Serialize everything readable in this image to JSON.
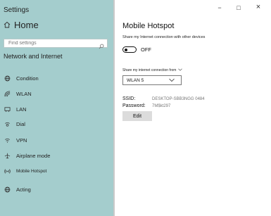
{
  "window": {
    "minimize_glyph": "−",
    "maximize_glyph": "□",
    "close_glyph": "×"
  },
  "sidebar": {
    "title": "Settings",
    "home_label": "Home",
    "search_placeholder": "Find settings",
    "section_title": "Network and Internet",
    "items": [
      {
        "label": "Condition",
        "icon": "globe-icon"
      },
      {
        "label": "WLAN",
        "icon": "wifi-icon"
      },
      {
        "label": "LAN",
        "icon": "ethernet-icon"
      },
      {
        "label": "Dial",
        "icon": "dialup-icon"
      },
      {
        "label": "VPN",
        "icon": "vpn-icon"
      },
      {
        "label": "Airplane mode",
        "icon": "airplane-icon"
      },
      {
        "label": "Mobile Hotspot",
        "icon": "hotspot-icon"
      },
      {
        "label": "Acting",
        "icon": "proxy-icon"
      }
    ]
  },
  "main": {
    "title": "Mobile Hotspot",
    "description": "Share my Internet connection with other devices",
    "toggle": {
      "state_label": "OFF",
      "on": false
    },
    "share_from_label": "Share my internet connection from",
    "share_from_value": "WLAN 5",
    "ssid_label": "SSID:",
    "ssid_value": "DESKTOP-SBB3NGG 0484",
    "password_label": "Password:",
    "password_value": "7M$kt297",
    "edit_label": "Edit"
  },
  "colors": {
    "sidebar_bg": "#a4cdcd",
    "page_bg": "#ffffff"
  }
}
